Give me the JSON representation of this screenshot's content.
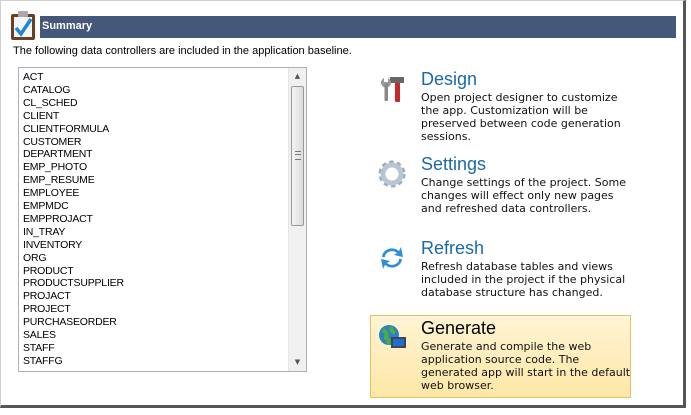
{
  "header": {
    "title": "Summary",
    "icon": "clipboard-check-icon"
  },
  "intro": "The following data controllers are included in the application baseline.",
  "controllers": [
    "ACT",
    "CATALOG",
    "CL_SCHED",
    "CLIENT",
    "CLIENTFORMULA",
    "CUSTOMER",
    "DEPARTMENT",
    "EMP_PHOTO",
    "EMP_RESUME",
    "EMPLOYEE",
    "EMPMDC",
    "EMPPROJACT",
    "IN_TRAY",
    "INVENTORY",
    "ORG",
    "PRODUCT",
    "PRODUCTSUPPLIER",
    "PROJACT",
    "PROJECT",
    "PURCHASEORDER",
    "SALES",
    "STAFF",
    "STAFFG"
  ],
  "actions": [
    {
      "title": "Design",
      "desc": "Open project designer to customize the app. Customization will be preserved between code generation sessions.",
      "icon": "tools-icon"
    },
    {
      "title": "Settings",
      "desc": "Change settings of the project. Some changes will effect only new pages and refreshed data controllers.",
      "icon": "gear-icon"
    },
    {
      "title": "Refresh",
      "desc": "Refresh database tables and views included in the project if the physical database structure has changed.",
      "icon": "refresh-icon"
    },
    {
      "title": "Generate",
      "desc": "Generate and compile the web application source code. The generated app will start in the default web browser.",
      "icon": "globe-computer-icon",
      "selected": true
    }
  ],
  "colors": {
    "header": "#46587a",
    "title": "#1b6aa5",
    "selected_bg": "#fde7a7",
    "selected_border": "#e3c060"
  }
}
